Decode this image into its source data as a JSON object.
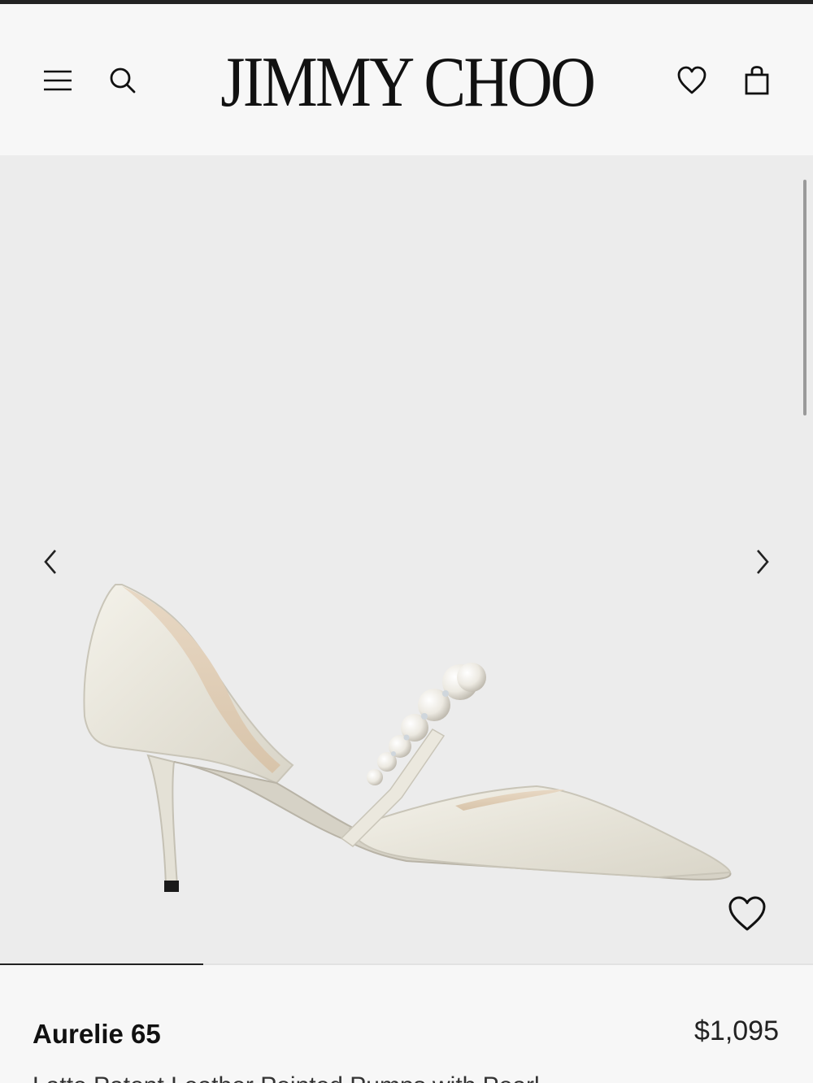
{
  "header": {
    "logo": "JIMMY CHOO",
    "icons": {
      "menu": "hamburger-menu-icon",
      "search": "search-icon",
      "wishlist": "heart-icon",
      "bag": "shopping-bag-icon"
    }
  },
  "gallery": {
    "prev_icon": "chevron-left-icon",
    "next_icon": "chevron-right-icon",
    "favorite_icon": "heart-icon",
    "image_progress": 0.25,
    "background_color": "#ececec"
  },
  "product": {
    "name": "Aurelie 65",
    "price": "$1,095",
    "description": "Latte Patent Leather Pointed Pumps with Pearl"
  }
}
